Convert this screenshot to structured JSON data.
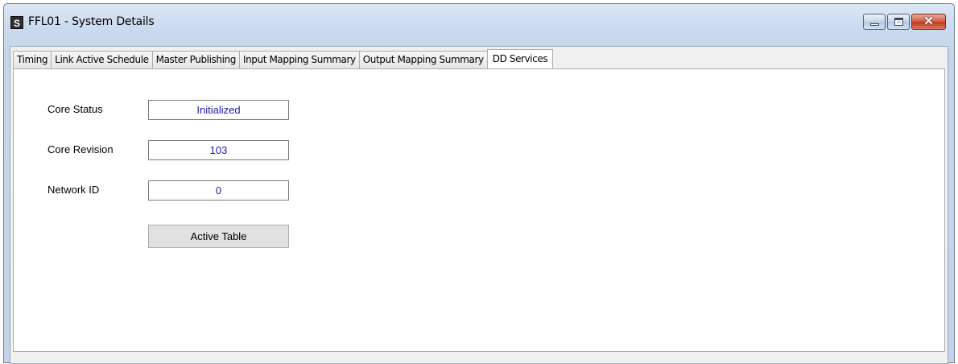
{
  "window": {
    "icon_letter": "S",
    "title": "FFL01 - System Details",
    "close_symbol": "✕"
  },
  "tabs": [
    {
      "label": "Timing",
      "active": false
    },
    {
      "label": "Link Active Schedule",
      "active": false
    },
    {
      "label": "Master Publishing",
      "active": false
    },
    {
      "label": "Input Mapping Summary",
      "active": false
    },
    {
      "label": "Output Mapping Summary",
      "active": false
    },
    {
      "label": "DD Services",
      "active": true
    }
  ],
  "dd_services": {
    "core_status": {
      "label": "Core Status",
      "value": "Initialized"
    },
    "core_revision": {
      "label": "Core Revision",
      "value": "103"
    },
    "network_id": {
      "label": "Network ID",
      "value": "0"
    },
    "active_table_button": "Active Table"
  },
  "colors": {
    "value_text": "#1a1aa6",
    "panel_bg": "#ffffff"
  }
}
